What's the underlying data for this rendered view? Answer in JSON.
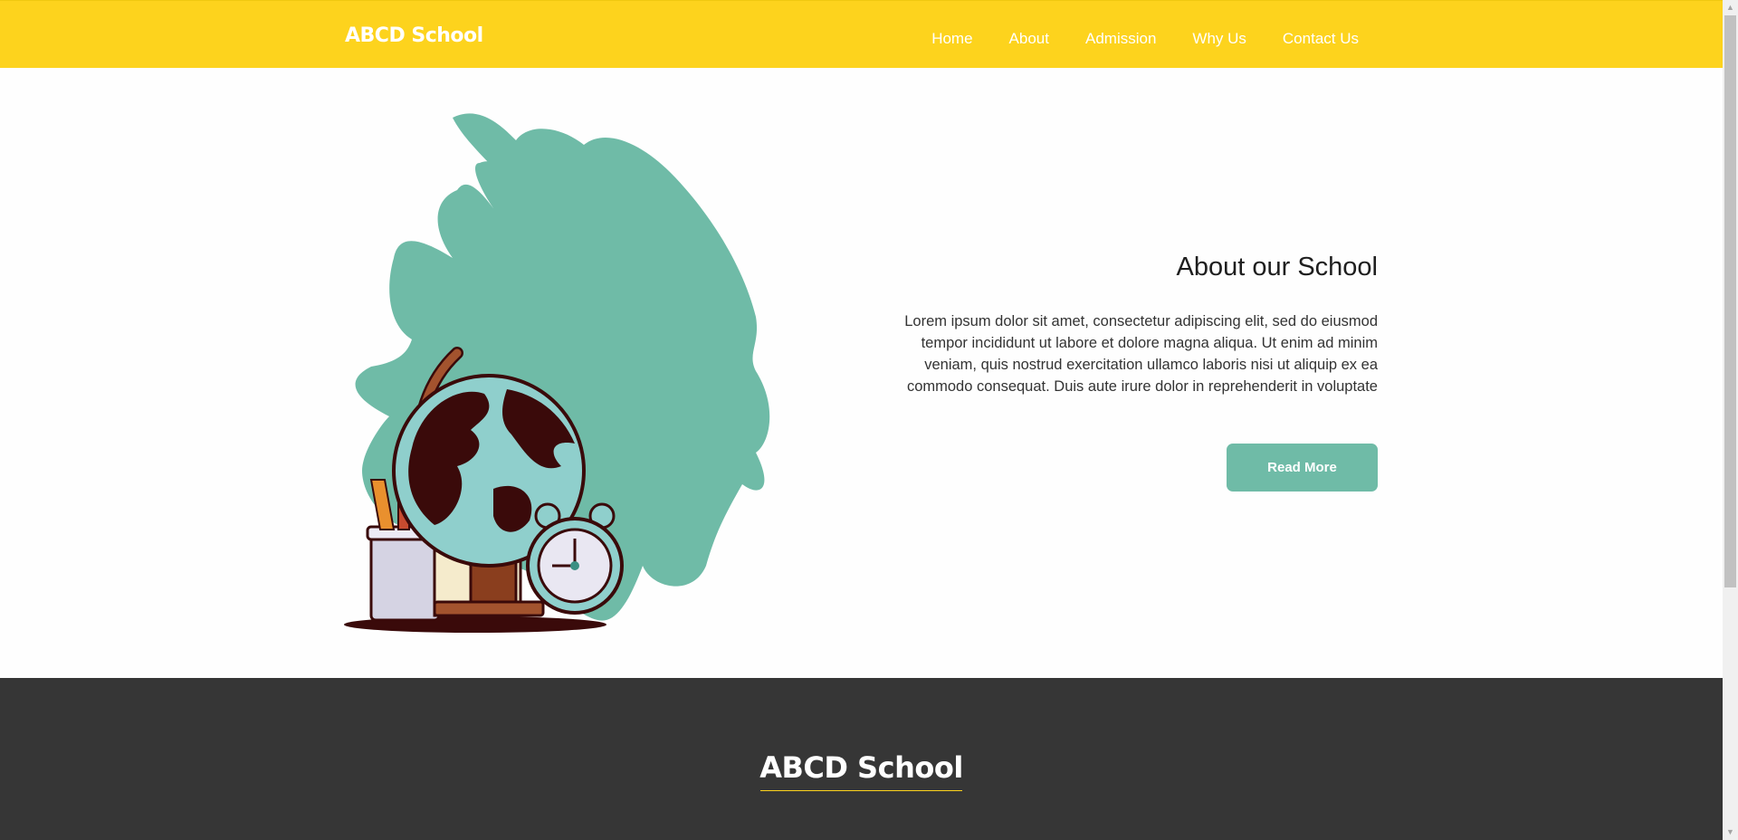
{
  "header": {
    "logo": "ABCD School",
    "nav": [
      "Home",
      "About",
      "Admission",
      "Why Us",
      "Contact Us"
    ]
  },
  "about": {
    "title": "About our School",
    "text": "Lorem ipsum dolor sit amet, consectetur adipiscing elit, sed do eiusmod tempor incididunt ut labore et dolore magna aliqua. Ut enim ad minim veniam, quis nostrud exercitation ullamco laboris nisi ut aliquip ex ea commodo consequat. Duis aute irure dolor in reprehenderit in voluptate",
    "button": "Read More",
    "illustration": "globe-with-alarm-clock-illustration"
  },
  "footer": {
    "title": "ABCD School"
  },
  "colors": {
    "header_bg": "#fdd31d",
    "accent_green": "#6fbba7",
    "footer_bg": "#363636",
    "globe_dark": "#3a0a0a",
    "globe_light": "#8fcfcc"
  }
}
